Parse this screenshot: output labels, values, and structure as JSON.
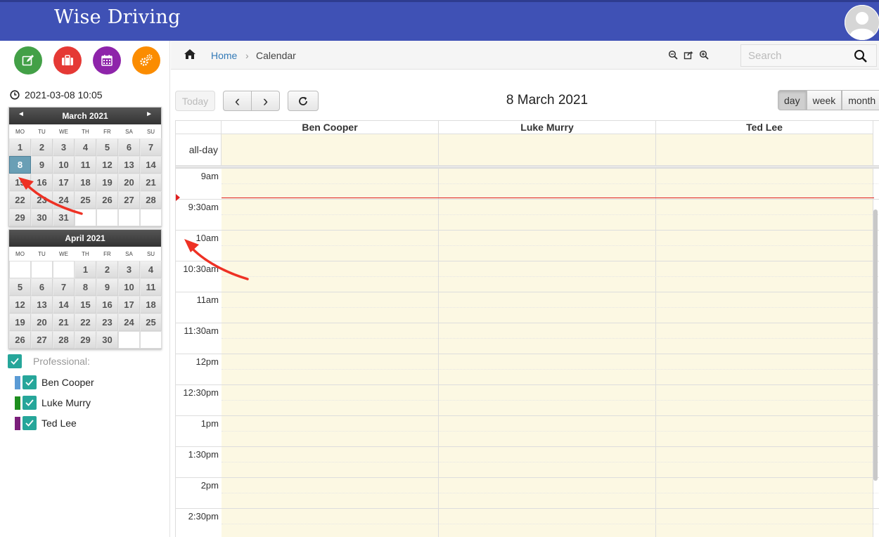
{
  "app": {
    "brand": "Wise Driving"
  },
  "sidebar": {
    "buttons": [
      {
        "name": "edit-button",
        "icon": "edit-icon",
        "color": "#43a047"
      },
      {
        "name": "briefcase-button",
        "icon": "briefcase-icon",
        "color": "#e53935"
      },
      {
        "name": "calendar-button",
        "icon": "calendar-icon",
        "color": "#8e24aa"
      },
      {
        "name": "settings-button",
        "icon": "gears-icon",
        "color": "#fb8c00"
      }
    ],
    "datetime": "2021-03-08 10:05",
    "weekdays": [
      "MO",
      "TU",
      "WE",
      "TH",
      "FR",
      "SA",
      "SU"
    ],
    "calendars": [
      {
        "title": "March 2021",
        "has_nav": true,
        "prev_glyph": "◄",
        "next_glyph": "►",
        "selected": "8",
        "days": [
          "1",
          "2",
          "3",
          "4",
          "5",
          "6",
          "7",
          "8",
          "9",
          "10",
          "11",
          "12",
          "13",
          "14",
          "15",
          "16",
          "17",
          "18",
          "19",
          "20",
          "21",
          "22",
          "23",
          "24",
          "25",
          "26",
          "27",
          "28",
          "29",
          "30",
          "31",
          "",
          "",
          "",
          ""
        ]
      },
      {
        "title": "April 2021",
        "has_nav": false,
        "selected": "",
        "days": [
          "",
          "",
          "",
          "1",
          "2",
          "3",
          "4",
          "5",
          "6",
          "7",
          "8",
          "9",
          "10",
          "11",
          "12",
          "13",
          "14",
          "15",
          "16",
          "17",
          "18",
          "19",
          "20",
          "21",
          "22",
          "23",
          "24",
          "25",
          "26",
          "27",
          "28",
          "29",
          "30",
          "",
          ""
        ]
      }
    ],
    "professional_label": "Professional:",
    "professionals": [
      {
        "name": "Ben Cooper",
        "color": "#5b9bd5"
      },
      {
        "name": "Luke Murry",
        "color": "#1e8e1e"
      },
      {
        "name": "Ted Lee",
        "color": "#7b1f7b"
      }
    ]
  },
  "breadcrumb": {
    "home": "Home",
    "separator": "›",
    "current": "Calendar"
  },
  "search": {
    "placeholder": "Search",
    "value": ""
  },
  "toolbar": {
    "today": "Today",
    "prev_glyph": "‹",
    "next_glyph": "›",
    "title": "8 March 2021",
    "views": [
      "day",
      "week",
      "month"
    ],
    "active_view": "day"
  },
  "calendar": {
    "resources": [
      "Ben Cooper",
      "Luke Murry",
      "Ted Lee"
    ],
    "allday_label": "all-day",
    "time_labels": [
      "9am",
      "9:30am",
      "10am",
      "10:30am",
      "11am",
      "11:30am",
      "12pm",
      "12:30pm",
      "1pm",
      "1:30pm",
      "2pm",
      "2:30pm"
    ],
    "now_time": "10:05"
  },
  "colors": {
    "header": "#3f51b5",
    "event_bg": "#fcf8e3",
    "now_indicator": "#e02020",
    "annotation_arrow": "#ee3124",
    "checkbox": "#26a69a"
  }
}
